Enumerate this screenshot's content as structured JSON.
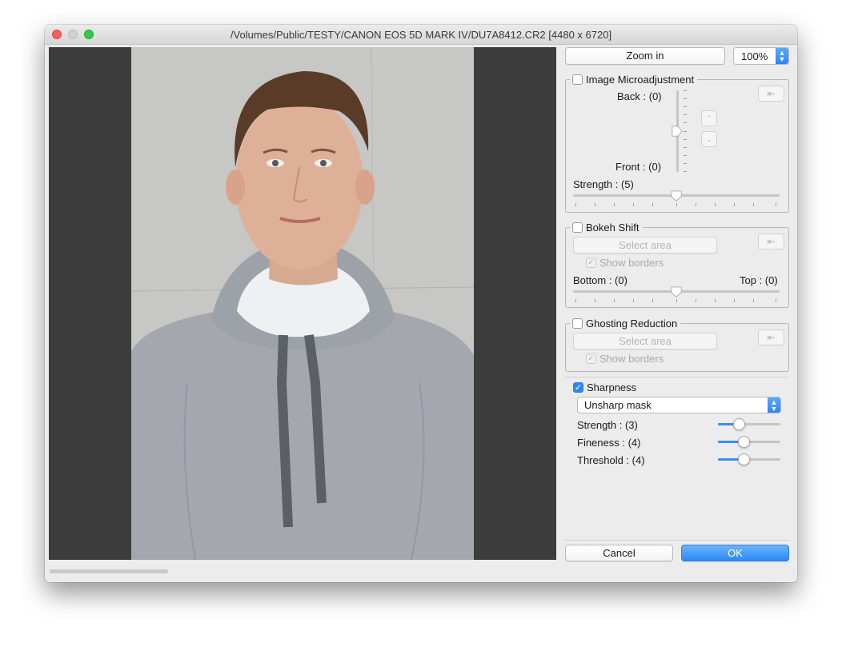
{
  "window": {
    "title": "/Volumes/Public/TESTY/CANON EOS 5D MARK IV/DU7A8412.CR2 [4480 x 6720]"
  },
  "toolbar": {
    "zoom_in_label": "Zoom in",
    "zoom_value": "100%"
  },
  "image_microadjustment": {
    "label": "Image Microadjustment",
    "checked": false,
    "back_label": "Back : (0)",
    "front_label": "Front : (0)",
    "strength_label": "Strength : (5)",
    "position_value": 0,
    "strength_value": 5,
    "reset_icon": "undo-arrow-icon",
    "up_icon": "chevron-up-icon",
    "down_icon": "chevron-down-icon"
  },
  "bokeh_shift": {
    "label": "Bokeh Shift",
    "checked": false,
    "select_area_label": "Select area",
    "show_borders_label": "Show borders",
    "show_borders_checked": true,
    "bottom_label": "Bottom : (0)",
    "top_label": "Top : (0)",
    "shift_value": 0,
    "reset_icon": "undo-arrow-icon"
  },
  "ghosting_reduction": {
    "label": "Ghosting Reduction",
    "checked": false,
    "select_area_label": "Select area",
    "show_borders_label": "Show borders",
    "show_borders_checked": true,
    "reset_icon": "undo-arrow-icon"
  },
  "sharpness": {
    "label": "Sharpness",
    "checked": true,
    "mode": "Unsharp mask",
    "strength_label": "Strength : (3)",
    "fineness_label": "Fineness : (4)",
    "threshold_label": "Threshold : (4)",
    "strength_value": 3,
    "fineness_value": 4,
    "threshold_value": 4
  },
  "footer": {
    "cancel_label": "Cancel",
    "ok_label": "OK"
  },
  "colors": {
    "accent": "#2a89f6",
    "window_bg": "#ececec",
    "preview_bg": "#3c3c3c"
  }
}
